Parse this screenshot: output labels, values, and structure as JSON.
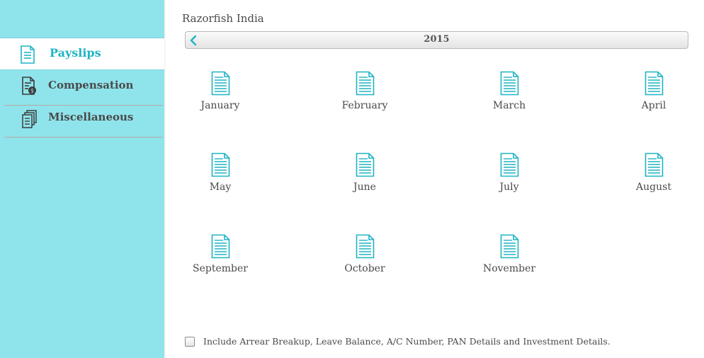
{
  "sidebar": {
    "items": [
      {
        "label": "Payslips",
        "icon": "payslip-icon",
        "active": true
      },
      {
        "label": "Compensation",
        "icon": "compensation-icon",
        "active": false
      },
      {
        "label": "Miscellaneous",
        "icon": "miscellaneous-icon",
        "active": false
      }
    ],
    "colors": {
      "background": "#8fe4ec",
      "active_text": "#1fb4c4"
    }
  },
  "header": {
    "company": "Razorfish India"
  },
  "year_nav": {
    "year": "2015",
    "prev_icon": "chevron-left-icon"
  },
  "months": [
    {
      "label": "January"
    },
    {
      "label": "February"
    },
    {
      "label": "March"
    },
    {
      "label": "April"
    },
    {
      "label": "May"
    },
    {
      "label": "June"
    },
    {
      "label": "July"
    },
    {
      "label": "August"
    },
    {
      "label": "September"
    },
    {
      "label": "October"
    },
    {
      "label": "November"
    }
  ],
  "options": {
    "include_details_label": "Include Arrear Breakup, Leave Balance, A/C Number, PAN Details and Investment Details.",
    "include_details_checked": false
  }
}
